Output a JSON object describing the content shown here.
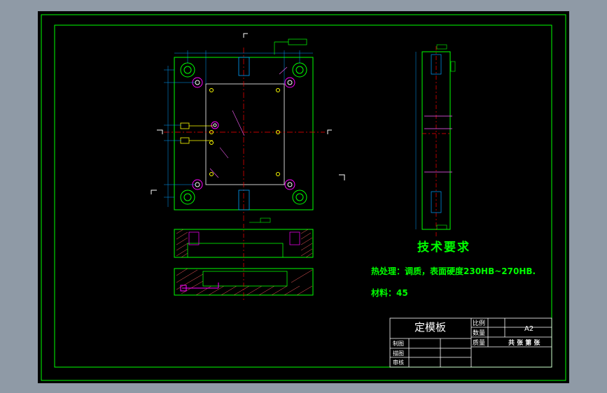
{
  "colors": {
    "background": "#000000",
    "frame": "#00ff00",
    "part_outline": "#00ff00",
    "center_line": "#ff0000",
    "dimension": "#00a0ff",
    "hatch": "#ff6060",
    "text_requirements": "#00ff00",
    "title_block_text": "#ffffff",
    "holes": "#ff00ff",
    "accent_yellow": "#ffff00"
  },
  "technical_requirements": {
    "heading": "技术要求",
    "heat_treatment": "热处理：调质，表面硬度230HB~270HB.",
    "material": "材料：45"
  },
  "title_block": {
    "part_name": "定模板",
    "scale_label": "比例",
    "quantity_label": "数量",
    "mass_label": "质量",
    "drawing_size": "A2",
    "sheet_info": "共  张  第  张",
    "drafter_label": "制图",
    "checker_label": "描图",
    "reviewer_label": "审核"
  }
}
